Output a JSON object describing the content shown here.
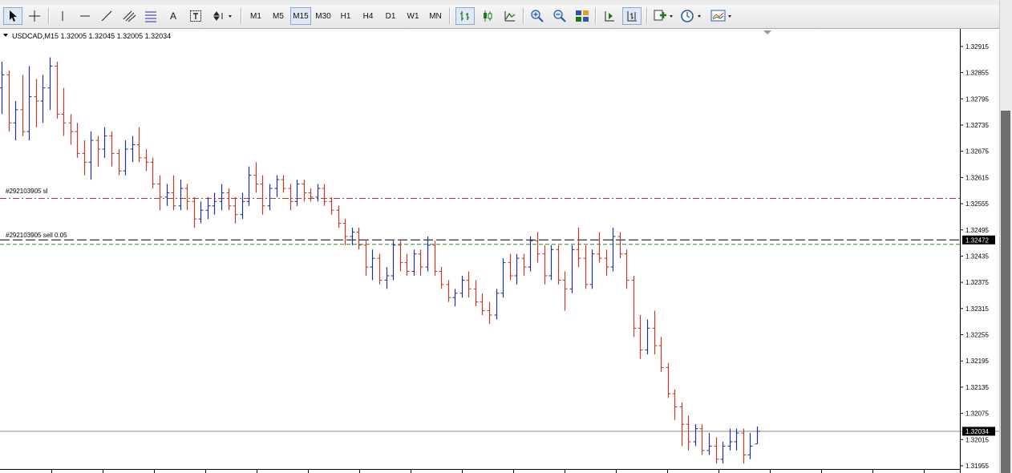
{
  "toolbar": {
    "timeframes": [
      "M1",
      "M5",
      "M15",
      "M30",
      "H1",
      "H4",
      "D1",
      "W1",
      "MN"
    ],
    "active_timeframe": "M15",
    "text_tool_label": "A"
  },
  "chart": {
    "header": "USDCAD,M15  1.32005 1.32045 1.32005 1.32034",
    "bid_label": "1.32034",
    "order_label": "1.32472",
    "sl_line_label": "#292103905 sl",
    "order_line_label": "#292103905 sell 0.05"
  },
  "colors": {
    "bull": "#1f2f9e",
    "bear": "#c0392b",
    "sl_line": "#c0392b",
    "order_line": "#000000",
    "second_line": "#2e8b2e",
    "bid_line": "#888888"
  },
  "chart_data": {
    "type": "bar",
    "symbol": "USDCAD",
    "timeframe": "M15",
    "ylim": [
      1.31955,
      1.32935
    ],
    "y_ticks": [
      "1.32915",
      "1.32855",
      "1.32795",
      "1.32735",
      "1.32675",
      "1.32615",
      "1.32555",
      "1.32495",
      "1.32435",
      "1.32375",
      "1.32315",
      "1.32255",
      "1.32195",
      "1.32135",
      "1.32075",
      "1.32015",
      "1.31955"
    ],
    "levels": {
      "sl": 1.32567,
      "order": 1.32472,
      "second": 1.32462,
      "bid": 1.32034
    },
    "ohlc": [
      [
        1.3282,
        1.3288,
        1.3276,
        1.3285
      ],
      [
        1.3285,
        1.3286,
        1.3272,
        1.3274
      ],
      [
        1.3274,
        1.3279,
        1.327,
        1.3277
      ],
      [
        1.3277,
        1.3285,
        1.3271,
        1.3272
      ],
      [
        1.3272,
        1.3287,
        1.327,
        1.328
      ],
      [
        1.328,
        1.3284,
        1.3273,
        1.3279
      ],
      [
        1.3279,
        1.3285,
        1.3274,
        1.3282
      ],
      [
        1.3282,
        1.3289,
        1.3277,
        1.3287
      ],
      [
        1.3287,
        1.3288,
        1.3275,
        1.3276
      ],
      [
        1.3276,
        1.3282,
        1.3271,
        1.3274
      ],
      [
        1.3274,
        1.3276,
        1.3269,
        1.3272
      ],
      [
        1.3272,
        1.3274,
        1.3266,
        1.3267
      ],
      [
        1.3267,
        1.327,
        1.3262,
        1.3265
      ],
      [
        1.3265,
        1.3272,
        1.3261,
        1.327
      ],
      [
        1.327,
        1.3271,
        1.3264,
        1.3268
      ],
      [
        1.3268,
        1.3273,
        1.3266,
        1.3271
      ],
      [
        1.3271,
        1.3272,
        1.3264,
        1.3267
      ],
      [
        1.3267,
        1.3268,
        1.3262,
        1.3263
      ],
      [
        1.3263,
        1.327,
        1.3262,
        1.3268
      ],
      [
        1.3268,
        1.3271,
        1.3265,
        1.3269
      ],
      [
        1.3269,
        1.3273,
        1.3265,
        1.3266
      ],
      [
        1.3266,
        1.3268,
        1.3263,
        1.3265
      ],
      [
        1.3265,
        1.3266,
        1.3259,
        1.326
      ],
      [
        1.326,
        1.3262,
        1.3254,
        1.3257
      ],
      [
        1.3257,
        1.326,
        1.3255,
        1.3258
      ],
      [
        1.3258,
        1.3262,
        1.3254,
        1.3255
      ],
      [
        1.3255,
        1.3261,
        1.3254,
        1.3259
      ],
      [
        1.3259,
        1.326,
        1.3254,
        1.3256
      ],
      [
        1.3256,
        1.3257,
        1.325,
        1.3252
      ],
      [
        1.3252,
        1.3256,
        1.3251,
        1.3254
      ],
      [
        1.3254,
        1.3257,
        1.3252,
        1.3255
      ],
      [
        1.3255,
        1.3258,
        1.3253,
        1.3256
      ],
      [
        1.3256,
        1.326,
        1.3254,
        1.3258
      ],
      [
        1.3258,
        1.3259,
        1.3254,
        1.3255
      ],
      [
        1.3255,
        1.3257,
        1.3251,
        1.3253
      ],
      [
        1.3253,
        1.3258,
        1.3252,
        1.3256
      ],
      [
        1.3256,
        1.3264,
        1.3255,
        1.3262
      ],
      [
        1.3262,
        1.3265,
        1.3258,
        1.326
      ],
      [
        1.326,
        1.3262,
        1.3253,
        1.3255
      ],
      [
        1.3255,
        1.326,
        1.3254,
        1.3259
      ],
      [
        1.3259,
        1.3262,
        1.3257,
        1.3261
      ],
      [
        1.3261,
        1.3262,
        1.3258,
        1.3259
      ],
      [
        1.3259,
        1.326,
        1.3254,
        1.3256
      ],
      [
        1.3256,
        1.3261,
        1.3255,
        1.326
      ],
      [
        1.326,
        1.3261,
        1.3256,
        1.3258
      ],
      [
        1.3258,
        1.3259,
        1.3256,
        1.3257
      ],
      [
        1.3257,
        1.326,
        1.3256,
        1.3259
      ],
      [
        1.3259,
        1.326,
        1.3255,
        1.3256
      ],
      [
        1.3256,
        1.3257,
        1.3253,
        1.3254
      ],
      [
        1.3254,
        1.3255,
        1.325,
        1.3251
      ],
      [
        1.3251,
        1.3252,
        1.3246,
        1.3248
      ],
      [
        1.3248,
        1.325,
        1.3246,
        1.3249
      ],
      [
        1.3249,
        1.325,
        1.3245,
        1.3246
      ],
      [
        1.3246,
        1.3247,
        1.3239,
        1.3241
      ],
      [
        1.3241,
        1.3245,
        1.3238,
        1.3243
      ],
      [
        1.3243,
        1.3244,
        1.3237,
        1.3238
      ],
      [
        1.3238,
        1.3241,
        1.3236,
        1.3239
      ],
      [
        1.3239,
        1.3247,
        1.3238,
        1.3246
      ],
      [
        1.3246,
        1.3247,
        1.324,
        1.3242
      ],
      [
        1.3242,
        1.3244,
        1.3239,
        1.324
      ],
      [
        1.324,
        1.3245,
        1.3239,
        1.3244
      ],
      [
        1.3244,
        1.3245,
        1.3239,
        1.3241
      ],
      [
        1.3241,
        1.3248,
        1.324,
        1.3246
      ],
      [
        1.3246,
        1.3247,
        1.3239,
        1.324
      ],
      [
        1.324,
        1.3241,
        1.3236,
        1.3237
      ],
      [
        1.3237,
        1.3238,
        1.3233,
        1.3234
      ],
      [
        1.3234,
        1.3236,
        1.3232,
        1.3235
      ],
      [
        1.3235,
        1.3239,
        1.3234,
        1.3238
      ],
      [
        1.3238,
        1.324,
        1.3234,
        1.3236
      ],
      [
        1.3236,
        1.3238,
        1.3232,
        1.3233
      ],
      [
        1.3233,
        1.3235,
        1.323,
        1.3231
      ],
      [
        1.3231,
        1.3233,
        1.3228,
        1.323
      ],
      [
        1.323,
        1.3236,
        1.3229,
        1.3235
      ],
      [
        1.3235,
        1.3243,
        1.3234,
        1.3242
      ],
      [
        1.3242,
        1.3244,
        1.3238,
        1.3239
      ],
      [
        1.3239,
        1.3244,
        1.3237,
        1.3243
      ],
      [
        1.3243,
        1.3244,
        1.3239,
        1.3241
      ],
      [
        1.3241,
        1.3248,
        1.324,
        1.3247
      ],
      [
        1.3247,
        1.3249,
        1.3242,
        1.3244
      ],
      [
        1.3244,
        1.3246,
        1.3237,
        1.3239
      ],
      [
        1.3239,
        1.3246,
        1.3238,
        1.3245
      ],
      [
        1.3245,
        1.3246,
        1.3237,
        1.3238
      ],
      [
        1.3238,
        1.324,
        1.3231,
        1.3236
      ],
      [
        1.3236,
        1.3246,
        1.3235,
        1.3245
      ],
      [
        1.3245,
        1.325,
        1.3241,
        1.3243
      ],
      [
        1.3243,
        1.3246,
        1.3236,
        1.3237
      ],
      [
        1.3237,
        1.3245,
        1.3236,
        1.3244
      ],
      [
        1.3244,
        1.3249,
        1.3242,
        1.3243
      ],
      [
        1.3243,
        1.3245,
        1.3239,
        1.3241
      ],
      [
        1.3241,
        1.325,
        1.324,
        1.3248
      ],
      [
        1.3248,
        1.3249,
        1.3243,
        1.3244
      ],
      [
        1.3244,
        1.3245,
        1.3236,
        1.3238
      ],
      [
        1.3238,
        1.3239,
        1.3225,
        1.3227
      ],
      [
        1.3227,
        1.323,
        1.322,
        1.3222
      ],
      [
        1.3222,
        1.3229,
        1.3221,
        1.3227
      ],
      [
        1.3227,
        1.3231,
        1.3221,
        1.3223
      ],
      [
        1.3223,
        1.3225,
        1.3217,
        1.3218
      ],
      [
        1.3218,
        1.3219,
        1.3211,
        1.3212
      ],
      [
        1.3212,
        1.3213,
        1.3206,
        1.3209
      ],
      [
        1.3209,
        1.321,
        1.32,
        1.3205
      ],
      [
        1.3205,
        1.3207,
        1.3199,
        1.3201
      ],
      [
        1.3201,
        1.3205,
        1.32,
        1.3204
      ],
      [
        1.3204,
        1.3205,
        1.3198,
        1.3199
      ],
      [
        1.3199,
        1.3203,
        1.3198,
        1.32
      ],
      [
        1.32,
        1.3202,
        1.3196,
        1.3197
      ],
      [
        1.3197,
        1.3201,
        1.3196,
        1.32
      ],
      [
        1.32,
        1.3204,
        1.3199,
        1.3201
      ],
      [
        1.3201,
        1.3204,
        1.3199,
        1.3203
      ],
      [
        1.3203,
        1.3204,
        1.3196,
        1.3198
      ],
      [
        1.3198,
        1.3203,
        1.3197,
        1.32
      ],
      [
        1.32005,
        1.32045,
        1.32005,
        1.32034
      ]
    ]
  }
}
